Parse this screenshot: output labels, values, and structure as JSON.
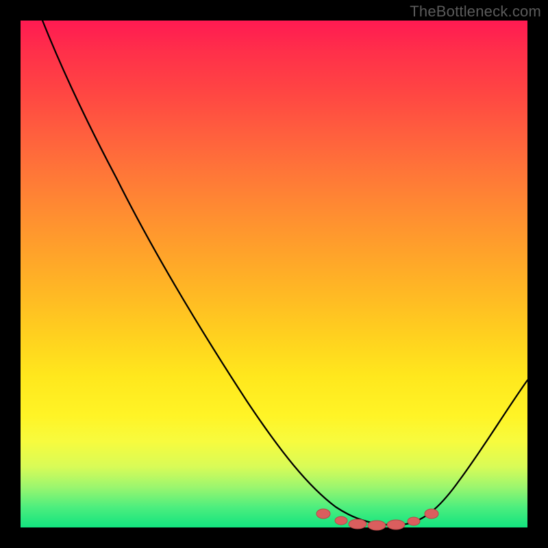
{
  "watermark": "TheBottleneck.com",
  "chart_data": {
    "type": "line",
    "title": "",
    "xlabel": "",
    "ylabel": "",
    "xlim": [
      0,
      100
    ],
    "ylim": [
      0,
      100
    ],
    "x": [
      0,
      10,
      20,
      30,
      40,
      50,
      55,
      60,
      64,
      68,
      72,
      76,
      80,
      85,
      90,
      95,
      100
    ],
    "values": [
      100,
      88,
      75,
      62,
      49,
      36,
      29,
      22,
      14,
      8,
      3,
      1,
      0.5,
      2,
      7,
      15,
      25
    ],
    "marker_region_x": [
      62,
      80
    ],
    "background_gradient": [
      "#ff1a52",
      "#12e47f"
    ]
  }
}
